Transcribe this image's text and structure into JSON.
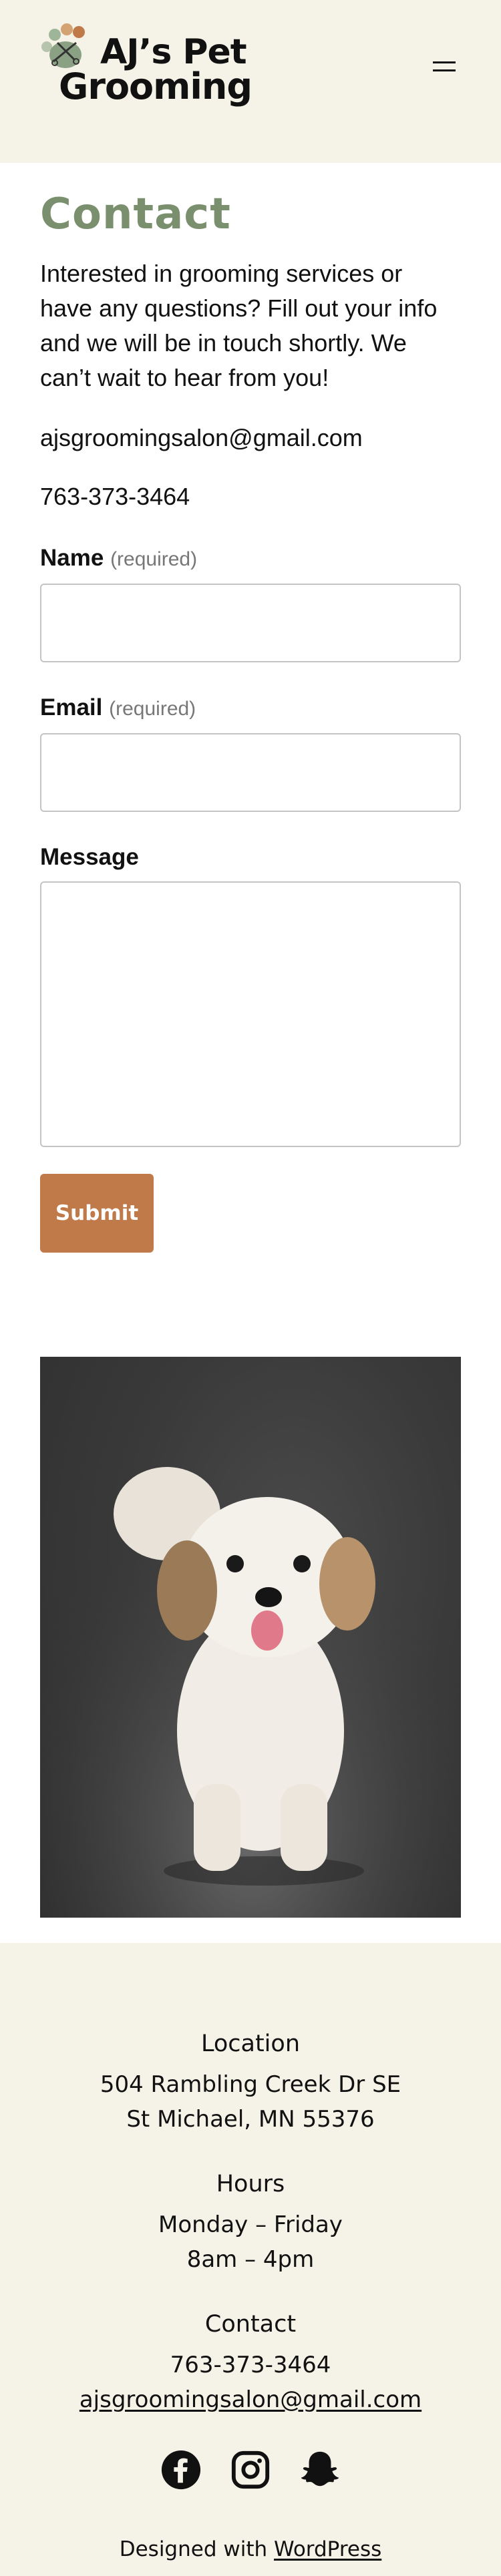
{
  "header": {
    "logo_line1": "AJ’s Pet",
    "logo_line2": "Grooming",
    "menu_icon": "hamburger-icon"
  },
  "main": {
    "title": "Contact",
    "intro": "Interested in grooming services or have any questions? Fill out your info and we will be in touch shortly. We can’t wait to hear from you!",
    "email": "ajsgroomingsalon@gmail.com",
    "phone": "763-373-3464",
    "form": {
      "name_label": "Name",
      "name_required": "(required)",
      "name_value": "",
      "email_label": "Email",
      "email_required": "(required)",
      "email_value": "",
      "message_label": "Message",
      "message_value": "",
      "submit_label": "Submit"
    },
    "photo": "dog-photo"
  },
  "footer": {
    "location_heading": "Location",
    "address_line1": "504 Rambling Creek Dr SE",
    "address_line2": "St Michael, MN 55376",
    "hours_heading": "Hours",
    "hours_days": "Monday – Friday",
    "hours_time": "8am – 4pm",
    "contact_heading": "Contact",
    "phone": "763-373-3464",
    "email": "ajsgroomingsalon@gmail.com",
    "social_icons": [
      "facebook-icon",
      "instagram-icon",
      "snapchat-icon"
    ],
    "credit_prefix": "Designed with",
    "credit_link": "WordPress"
  },
  "colors": {
    "cream": "#f5f3e8",
    "title_green": "#7a8f6e",
    "button_brown": "#c07a49"
  }
}
